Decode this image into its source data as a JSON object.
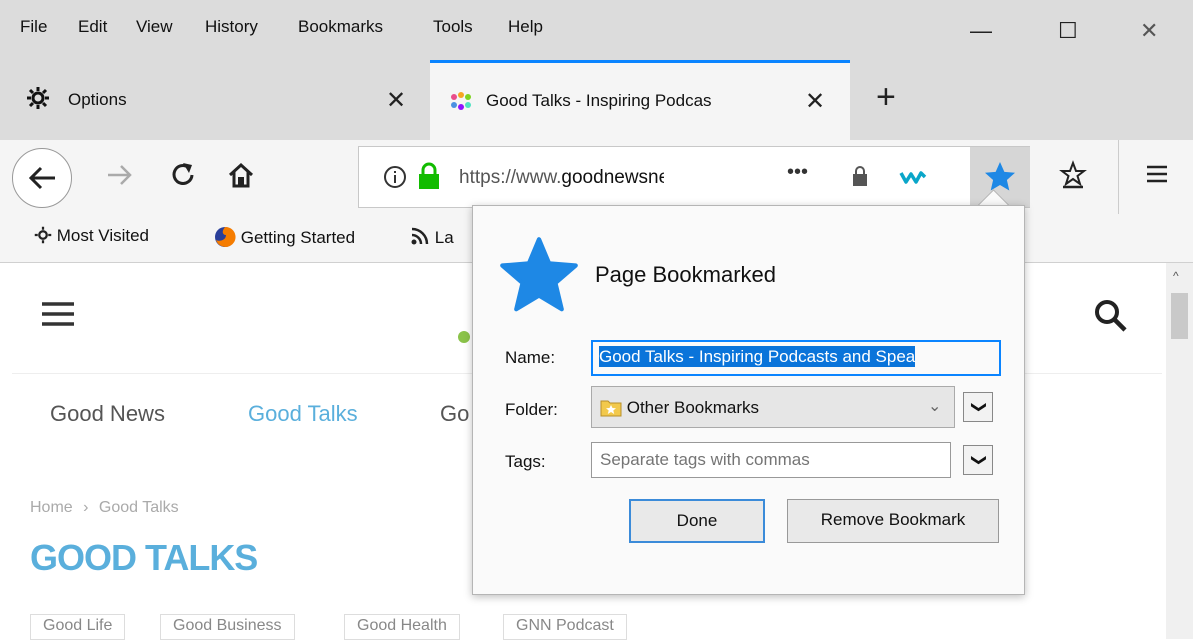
{
  "menu": [
    "File",
    "Edit",
    "View",
    "History",
    "Bookmarks",
    "Tools",
    "Help"
  ],
  "window_controls": {
    "minimize": "—",
    "maximize": "☐",
    "close": "✕"
  },
  "tabs": [
    {
      "title": "Options",
      "icon": "gear-icon"
    },
    {
      "title": "Good Talks - Inspiring Podcas",
      "icon": "site-favicon"
    }
  ],
  "new_tab": "+",
  "url": {
    "prefix": "https://www.",
    "domain": "goodnewsne"
  },
  "page_actions": "•••",
  "bookmarks_toolbar": [
    {
      "label": "Most Visited",
      "icon": "gear-icon"
    },
    {
      "label": "Getting Started",
      "icon": "firefox-icon"
    },
    {
      "label": "La",
      "icon": "rss-icon"
    }
  ],
  "site": {
    "nav": [
      "Good News",
      "Good Talks",
      "Go"
    ],
    "breadcrumb": [
      "Home",
      "›",
      "Good Talks"
    ],
    "heading": "GOOD TALKS",
    "tags": [
      "Good Life",
      "Good Business",
      "Good Health",
      "GNN Podcast"
    ]
  },
  "popup": {
    "title": "Page Bookmarked",
    "name_label": "Name:",
    "name_value": "Good Talks - Inspiring Podcasts and Spea",
    "folder_label": "Folder:",
    "folder_value": "Other Bookmarks",
    "tags_label": "Tags:",
    "tags_placeholder": "Separate tags with commas",
    "done": "Done",
    "remove": "Remove Bookmark"
  },
  "colors": {
    "accent": "#0a84ff",
    "star": "#1e88e5",
    "site_blue": "#5aafdc",
    "secure_green": "#12bc00"
  }
}
